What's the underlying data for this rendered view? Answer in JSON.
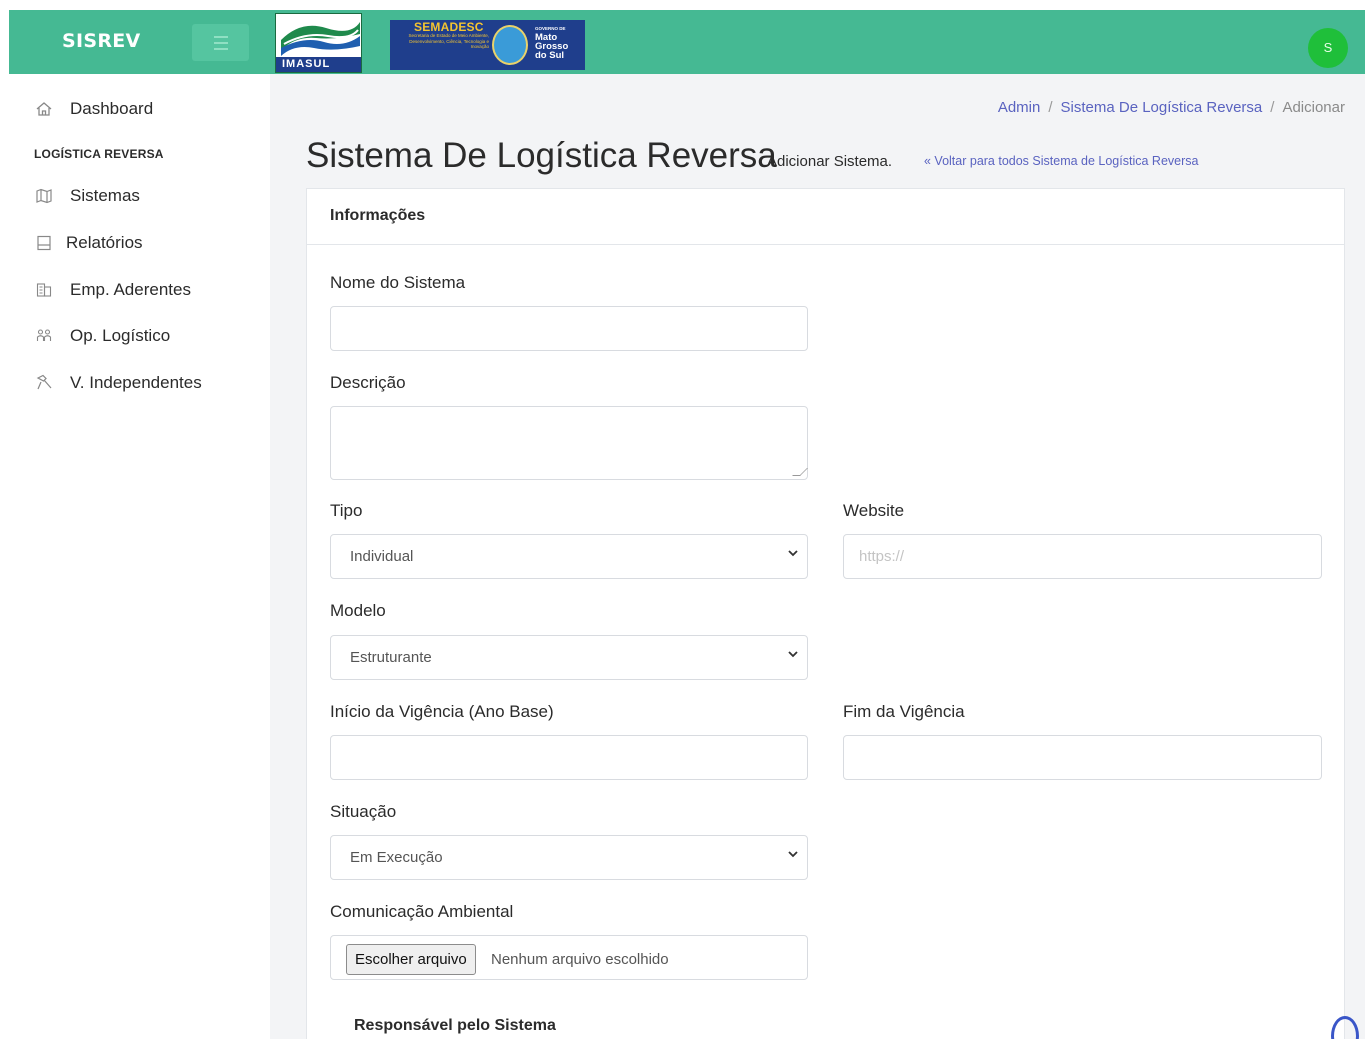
{
  "app": {
    "brand": "SISREV",
    "logos": {
      "imasul": "IMASUL",
      "semadesc_title": "SEMADESC",
      "semadesc_lines": "Secretaria de Estado de Meio Ambiente, Desenvolvimento, Ciência, Tecnologia e Inovação",
      "gov_small": "GOVERNO DE",
      "gov_name": "Mato Grosso do Sul"
    },
    "user_initial": "S",
    "colors": {
      "topbar": "#45b993",
      "link": "#5a63c0",
      "avatar": "#1fbf3a"
    }
  },
  "sidebar": {
    "dashboard": {
      "label": "Dashboard",
      "icon": "home-icon"
    },
    "section_heading": "LOGÍSTICA REVERSA",
    "items": [
      {
        "label": "Sistemas",
        "icon": "map-icon"
      },
      {
        "label": "Relatórios",
        "icon": "document-icon"
      },
      {
        "label": "Emp. Aderentes",
        "icon": "building-icon"
      },
      {
        "label": "Op. Logístico",
        "icon": "people-icon"
      },
      {
        "label": "V. Independentes",
        "icon": "hammer-icon"
      }
    ]
  },
  "breadcrumb": {
    "items": [
      "Admin",
      "Sistema De Logística Reversa",
      "Adicionar"
    ],
    "separator": "/"
  },
  "page": {
    "title": "Sistema De Logística Reversa",
    "subtitle": "Adicionar Sistema.",
    "back_link": "« Voltar para todos Sistema de Logística Reversa"
  },
  "form": {
    "card_title": "Informações",
    "nome": {
      "label": "Nome do Sistema",
      "value": ""
    },
    "descricao": {
      "label": "Descrição",
      "value": ""
    },
    "tipo": {
      "label": "Tipo",
      "value": "Individual"
    },
    "website": {
      "label": "Website",
      "placeholder": "https://"
    },
    "modelo": {
      "label": "Modelo",
      "value": "Estruturante"
    },
    "inicio": {
      "label": "Início da Vigência (Ano Base)",
      "value": ""
    },
    "fim": {
      "label": "Fim da Vigência",
      "value": ""
    },
    "situacao": {
      "label": "Situação",
      "value": "Em Execução"
    },
    "comunicacao": {
      "label": "Comunicação Ambiental",
      "button": "Escolher arquivo",
      "status": "Nenhum arquivo escolhido"
    },
    "responsavel_heading": "Responsável pelo Sistema"
  }
}
